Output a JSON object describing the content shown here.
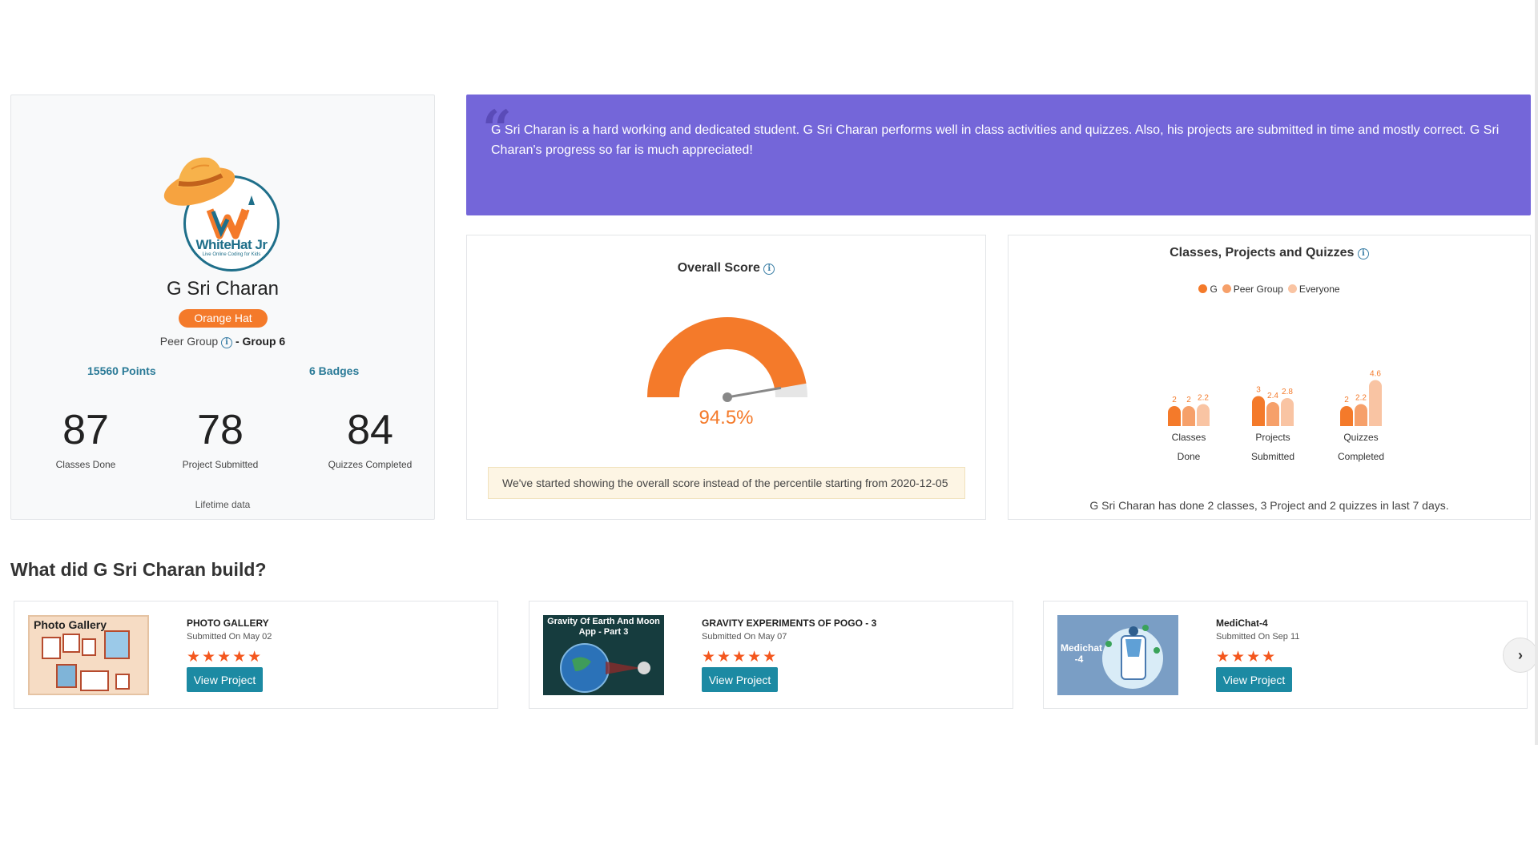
{
  "profile": {
    "brand": "WhiteHat Jr",
    "brand_sub": "Live Online Coding for Kids",
    "name": "G Sri Charan",
    "hat": "Orange Hat",
    "peer_group_label": "Peer Group",
    "peer_group_value": "- Group 6",
    "points": "15560 Points",
    "badges": "6 Badges",
    "stats": [
      {
        "value": "87",
        "label": "Classes Done"
      },
      {
        "value": "78",
        "label": "Project Submitted"
      },
      {
        "value": "84",
        "label": "Quizzes Completed"
      }
    ],
    "footer": "Lifetime data"
  },
  "quote": {
    "text": "G Sri Charan is a hard working and dedicated student. G Sri Charan performs well in class activities and quizzes. Also, his projects are submitted in time and mostly correct. G Sri Charan's progress so far is much appreciated!"
  },
  "score": {
    "title": "Overall Score",
    "value": "94.5%",
    "value_fraction": 0.945,
    "notice": "We've started showing the overall score instead of the percentile starting from 2020-12-05"
  },
  "cpq": {
    "title": "Classes, Projects and Quizzes",
    "summary": "G Sri Charan has done 2 classes, 3 Project and 2 quizzes in last 7 days."
  },
  "chart_data": {
    "type": "bar",
    "title": "Classes, Projects and Quizzes",
    "categories": [
      "Classes Done",
      "Projects Submitted",
      "Quizzes Completed"
    ],
    "category_lines": [
      [
        "Classes",
        "Done"
      ],
      [
        "Projects",
        "Submitted"
      ],
      [
        "Quizzes",
        "Completed"
      ]
    ],
    "series": [
      {
        "name": "G",
        "values": [
          2,
          3,
          2
        ],
        "color": "#f47a2a"
      },
      {
        "name": "Peer Group",
        "values": [
          2,
          2.4,
          2.2
        ],
        "color": "#f6a06a"
      },
      {
        "name": "Everyone",
        "values": [
          2.2,
          2.8,
          4.6
        ],
        "color": "#f9c4a3"
      }
    ],
    "legend": "top-center",
    "grid": false
  },
  "build": {
    "heading": "What did G Sri Charan build?",
    "projects": [
      {
        "title": "PHOTO GALLERY",
        "date": "Submitted On May 02",
        "stars": "★★★★★",
        "button": "View Project",
        "thumb_text": "Photo Gallery"
      },
      {
        "title": "GRAVITY EXPERIMENTS OF POGO - 3",
        "date": "Submitted On May 07",
        "stars": "★★★★★",
        "button": "View Project",
        "thumb_text": "Gravity Of Earth And Moon App - Part 3"
      },
      {
        "title": "MediChat-4",
        "date": "Submitted On Sep 11",
        "stars": "★★★★",
        "button": "View Project",
        "thumb_text": "Medichat -4"
      }
    ],
    "next_icon": "chevron-right-icon"
  }
}
